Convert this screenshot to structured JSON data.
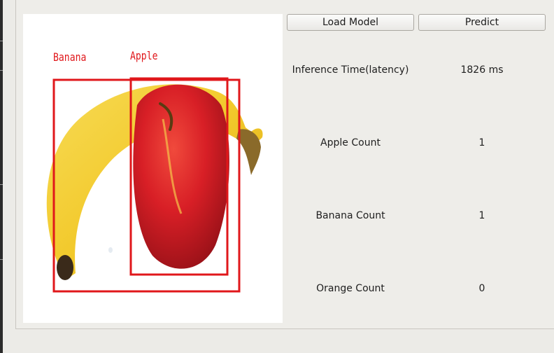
{
  "toolbar": {
    "load_model_label": "Load Model",
    "predict_label": "Predict"
  },
  "detections": [
    {
      "label": "Banana"
    },
    {
      "label": "Apple"
    }
  ],
  "metrics": {
    "inference_time": {
      "label": "Inference Time(latency)",
      "value": "1826 ms"
    },
    "apple_count": {
      "label": "Apple Count",
      "value": "1"
    },
    "banana_count": {
      "label": "Banana Count",
      "value": "1"
    },
    "orange_count": {
      "label": "Orange Count",
      "value": "0"
    }
  },
  "colors": {
    "box": "#e0171b",
    "window_bg": "#ecebe7"
  }
}
